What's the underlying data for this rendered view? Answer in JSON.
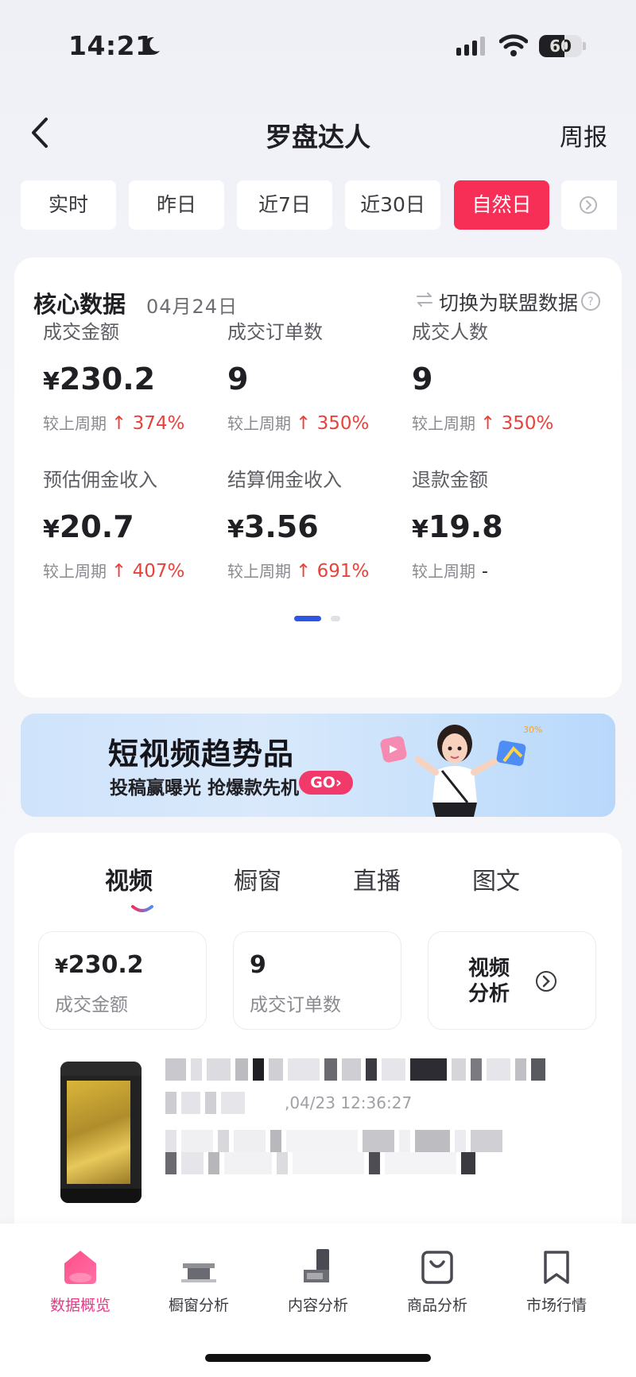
{
  "status": {
    "time": "14:21",
    "battery": "60",
    "battery_level": 0.6
  },
  "nav": {
    "title": "罗盘达人",
    "weekly": "周报"
  },
  "period_tabs": [
    {
      "label": "实时",
      "active": false
    },
    {
      "label": "昨日",
      "active": false
    },
    {
      "label": "近7日",
      "active": false
    },
    {
      "label": "近30日",
      "active": false
    },
    {
      "label": "自然日",
      "active": true
    }
  ],
  "core": {
    "title": "核心数据",
    "date": "04月24日",
    "switch_label": "切换为联盟数据",
    "metrics": [
      {
        "label": "成交金额",
        "currency": "¥",
        "value": "230.2",
        "compare_label": "较上周期",
        "change": "↑ 374%"
      },
      {
        "label": "成交订单数",
        "currency": "",
        "value": "9",
        "compare_label": "较上周期",
        "change": "↑ 350%"
      },
      {
        "label": "成交人数",
        "currency": "",
        "value": "9",
        "compare_label": "较上周期",
        "change": "↑ 350%"
      },
      {
        "label": "预估佣金收入",
        "currency": "¥",
        "value": "20.7",
        "compare_label": "较上周期",
        "change": "↑ 407%"
      },
      {
        "label": "结算佣金收入",
        "currency": "¥",
        "value": "3.56",
        "compare_label": "较上周期",
        "change": "↑ 691%"
      },
      {
        "label": "退款金额",
        "currency": "¥",
        "value": "19.8",
        "compare_label": "较上周期",
        "change": "-"
      }
    ]
  },
  "banner": {
    "title": "短视频趋势品",
    "subtitle": "投稿赢曝光 抢爆款先机",
    "go": "GO›"
  },
  "content": {
    "tabs": [
      {
        "label": "视频",
        "active": true
      },
      {
        "label": "橱窗",
        "active": false
      },
      {
        "label": "直播",
        "active": false
      },
      {
        "label": "图文",
        "active": false
      }
    ],
    "stats": [
      {
        "currency": "¥",
        "value": "230.2",
        "label": "成交金额"
      },
      {
        "currency": "",
        "value": "9",
        "label": "成交订单数"
      }
    ],
    "analysis_label": "视频分析",
    "video_time": ",04/23 12:36:27"
  },
  "bottom_nav": [
    {
      "label": "数据概览",
      "active": true
    },
    {
      "label": "橱窗分析",
      "active": false
    },
    {
      "label": "内容分析",
      "active": false
    },
    {
      "label": "商品分析",
      "active": false
    },
    {
      "label": "市场行情",
      "active": false
    }
  ],
  "colors": {
    "accent": "#f72f57",
    "up": "#e8423b",
    "pager": "#2f55e4",
    "nav_active": "#e83a87"
  }
}
